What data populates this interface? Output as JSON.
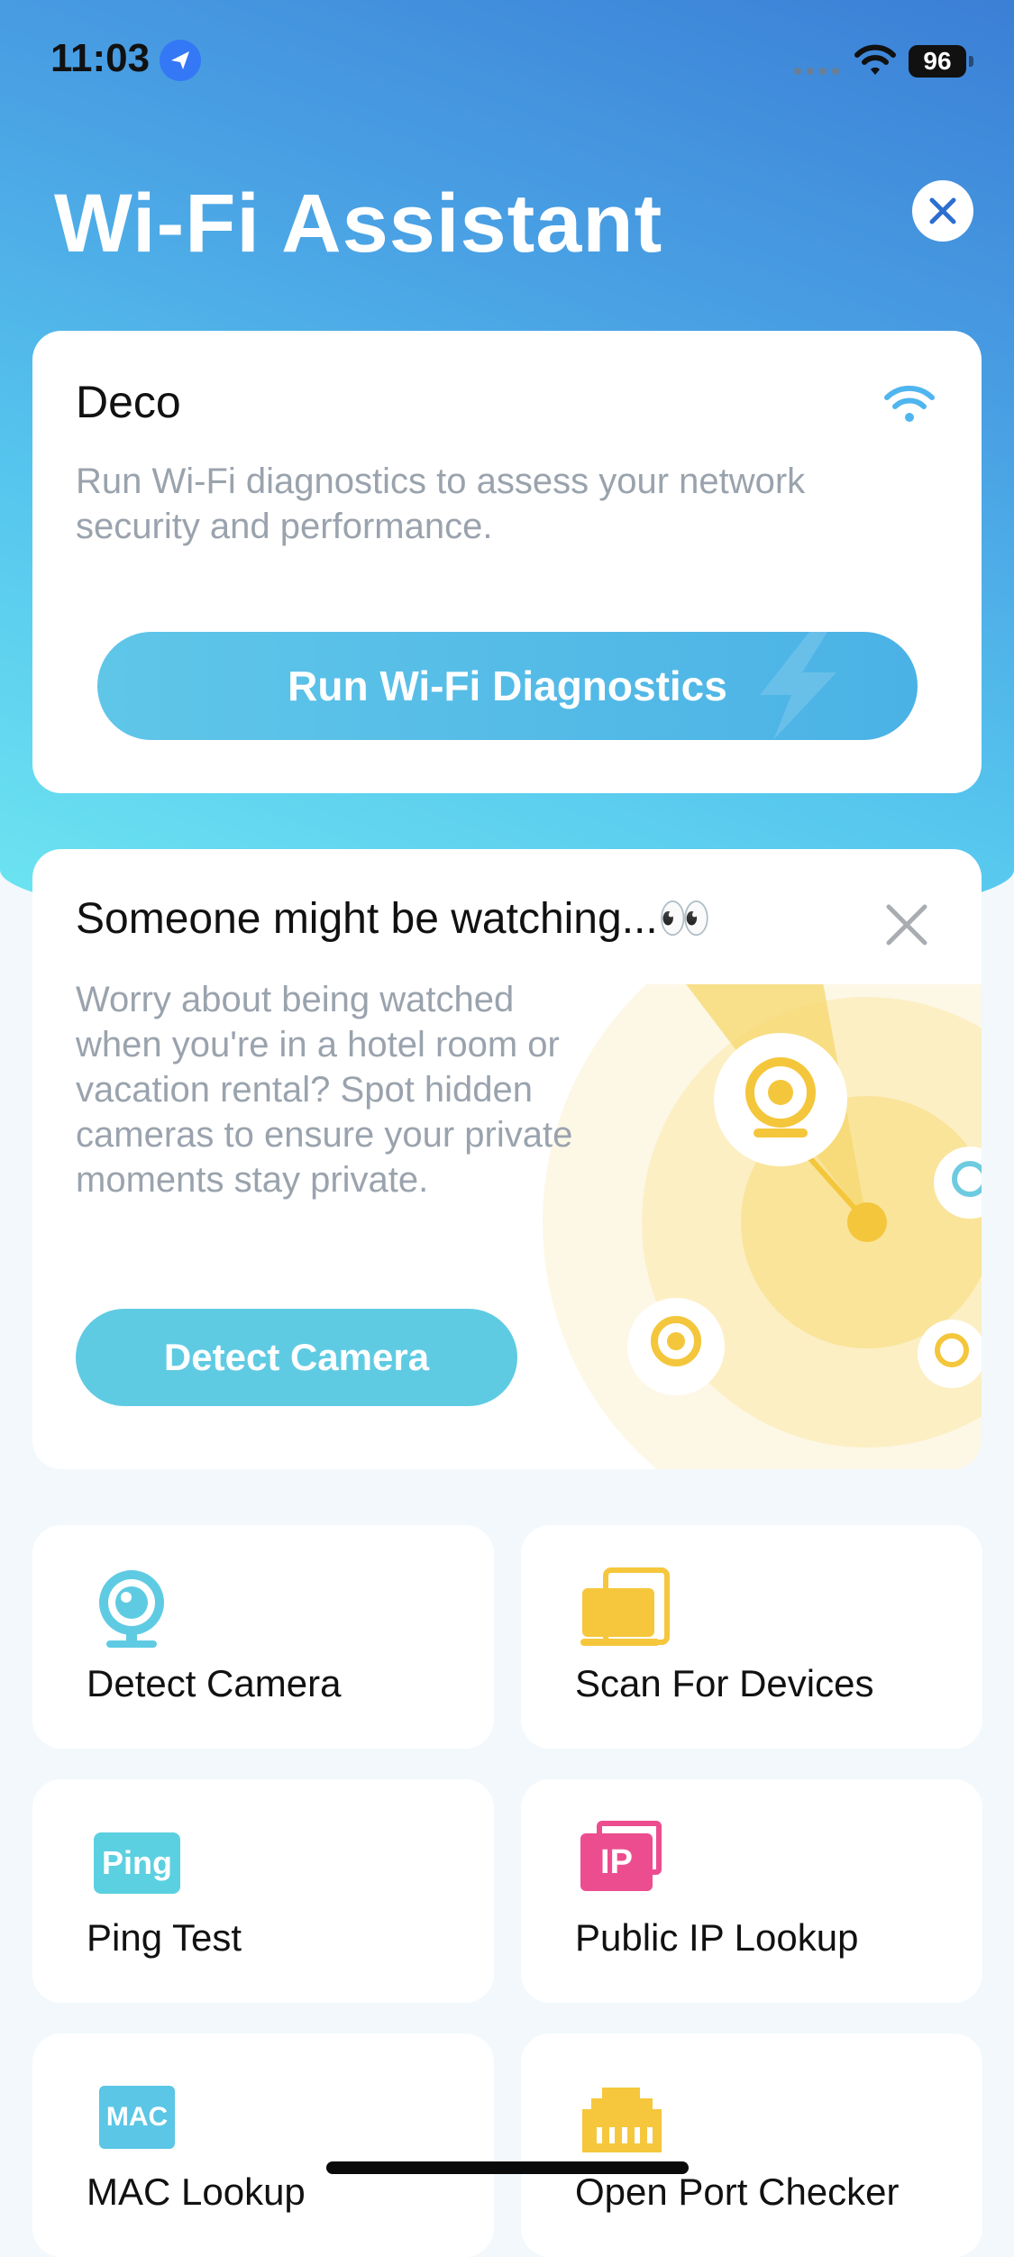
{
  "status_bar": {
    "time": "11:03",
    "battery": "96"
  },
  "header": {
    "title": "Wi-Fi Assistant"
  },
  "deco_card": {
    "title": "Deco",
    "description": "Run Wi-Fi diagnostics to assess your network security and performance.",
    "button_label": "Run Wi-Fi Diagnostics"
  },
  "camera_card": {
    "title": "Someone might be watching...👀",
    "description": "Worry about being watched when you're in a hotel room or vacation rental? Spot hidden cameras to ensure your private moments stay private.",
    "button_label": "Detect Camera"
  },
  "tools": [
    {
      "label": "Detect Camera",
      "icon": "camera-icon"
    },
    {
      "label": "Scan For Devices",
      "icon": "devices-icon"
    },
    {
      "label": "Ping Test",
      "icon": "ping-icon",
      "badge": "Ping"
    },
    {
      "label": "Public IP Lookup",
      "icon": "ip-icon",
      "badge": "IP"
    },
    {
      "label": "MAC Lookup",
      "icon": "mac-icon",
      "badge": "MAC"
    },
    {
      "label": "Open Port Checker",
      "icon": "port-icon"
    }
  ],
  "colors": {
    "accent_blue": "#4bb2e6",
    "camera_teal": "#5fcbe3",
    "camera_yellow": "#f4c63c",
    "ping_teal": "#5bd0e0",
    "ip_pink": "#ec4d8f",
    "mac_teal": "#5bc6e6",
    "port_yellow": "#f6c73c"
  }
}
